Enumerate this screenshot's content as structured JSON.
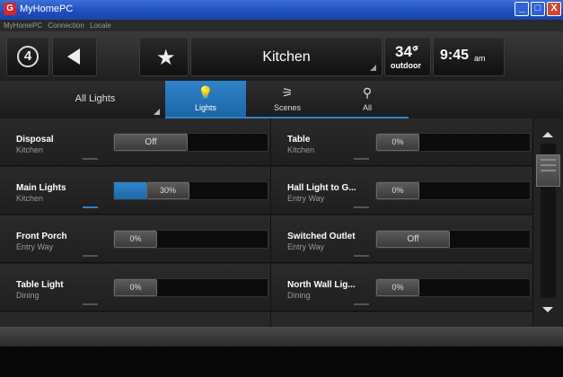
{
  "window": {
    "title": "MyHomePC",
    "app_icon": "app-logo-icon",
    "minimize_glyph": "_",
    "maximize_glyph": "□",
    "close_glyph": "X"
  },
  "menu": [
    "MyHomePC",
    "Connection",
    "Locale"
  ],
  "toolbar": {
    "logo_glyph": "4",
    "room_label": "Kitchen",
    "temperature": "34°",
    "temperature_unit": "F",
    "temperature_label": "outdoor",
    "time": "9:45",
    "ampm": "am",
    "icons": {
      "logo": "home-logo-icon",
      "back": "back-arrow-icon",
      "favorite": "star-icon"
    }
  },
  "tabs": {
    "filter_label": "All Lights",
    "items": [
      {
        "label": "Lights",
        "icon": "lightbulb-icon",
        "glyph": "💡",
        "active": true
      },
      {
        "label": "Scenes",
        "icon": "scenes-icon",
        "glyph": "⚞",
        "active": false
      },
      {
        "label": "All",
        "icon": "all-devices-icon",
        "glyph": "⚲",
        "active": false
      }
    ]
  },
  "devices": [
    {
      "name": "Disposal",
      "room": "Kitchen",
      "control": "Off",
      "level": 0,
      "type": "switch",
      "active": false
    },
    {
      "name": "Table",
      "room": "Kitchen",
      "control": "0%",
      "level": 0,
      "type": "dimmer",
      "active": false
    },
    {
      "name": "Main Lights",
      "room": "Kitchen",
      "control": "30%",
      "level": 30,
      "type": "dimmer",
      "active": true
    },
    {
      "name": "Hall Light to G...",
      "room": "Entry Way",
      "control": "0%",
      "level": 0,
      "type": "dimmer",
      "active": false
    },
    {
      "name": "Front Porch",
      "room": "Entry Way",
      "control": "0%",
      "level": 0,
      "type": "dimmer",
      "active": false
    },
    {
      "name": "Switched Outlet",
      "room": "Entry Way",
      "control": "Off",
      "level": 0,
      "type": "switch",
      "active": false
    },
    {
      "name": "Table Light",
      "room": "Dining",
      "control": "0%",
      "level": 0,
      "type": "dimmer",
      "active": false
    },
    {
      "name": "North Wall Lig...",
      "room": "Dining",
      "control": "0%",
      "level": 0,
      "type": "dimmer",
      "active": false
    }
  ],
  "colors": {
    "accent": "#2f83c9",
    "background": "#1c1c1c",
    "titlebar": "#1f4fbf"
  }
}
